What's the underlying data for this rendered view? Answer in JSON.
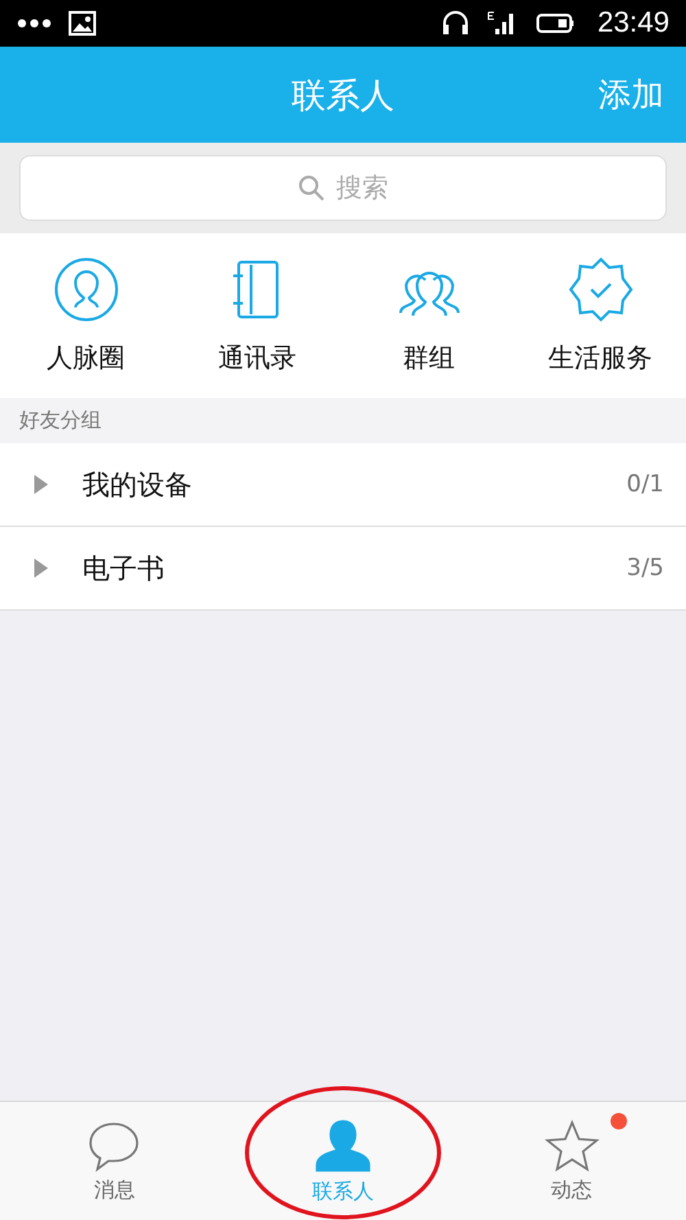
{
  "status_bar": {
    "time": "23:49"
  },
  "header": {
    "title": "联系人",
    "action": "添加"
  },
  "search": {
    "placeholder": "搜索"
  },
  "shortcuts": [
    {
      "kind": "circle",
      "label": "人脉圈"
    },
    {
      "kind": "book",
      "label": "通讯录"
    },
    {
      "kind": "group",
      "label": "群组"
    },
    {
      "kind": "badge",
      "label": "生活服务"
    }
  ],
  "section_title": "好友分组",
  "groups": [
    {
      "name": "我的设备",
      "count": "0/1",
      "expanded": false
    },
    {
      "name": "电子书",
      "count": "3/5",
      "expanded": false
    }
  ],
  "tabs": [
    {
      "kind": "chat",
      "label": "消息",
      "selected": false,
      "dot": false
    },
    {
      "kind": "person",
      "label": "联系人",
      "selected": true,
      "dot": false
    },
    {
      "kind": "star",
      "label": "动态",
      "selected": false,
      "dot": true
    }
  ]
}
